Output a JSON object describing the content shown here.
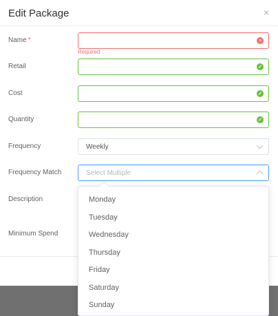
{
  "modal": {
    "title": "Edit Package",
    "close_icon": "×"
  },
  "form": {
    "name": {
      "label": "Name",
      "required_mark": "*",
      "value": "",
      "error": "Required",
      "status_icon": "error-circle-icon"
    },
    "retail": {
      "label": "Retail",
      "value": "",
      "status_icon": "success-check-icon"
    },
    "cost": {
      "label": "Cost",
      "value": "",
      "status_icon": "success-check-icon"
    },
    "quantity": {
      "label": "Quantity",
      "value": "",
      "status_icon": "success-check-icon"
    },
    "frequency": {
      "label": "Frequency",
      "selected": "Weekly"
    },
    "frequency_match": {
      "label": "Frequency Match",
      "placeholder": "Select Multiple"
    },
    "description": {
      "label": "Description"
    },
    "minimum_spend": {
      "label": "Minimum Spend"
    }
  },
  "dropdown": {
    "options": [
      "Monday",
      "Tuesday",
      "Wednesday",
      "Thursday",
      "Friday",
      "Saturday",
      "Sunday"
    ]
  },
  "colors": {
    "error": "#f56c6c",
    "success": "#67c23a",
    "focus": "#409eff"
  }
}
